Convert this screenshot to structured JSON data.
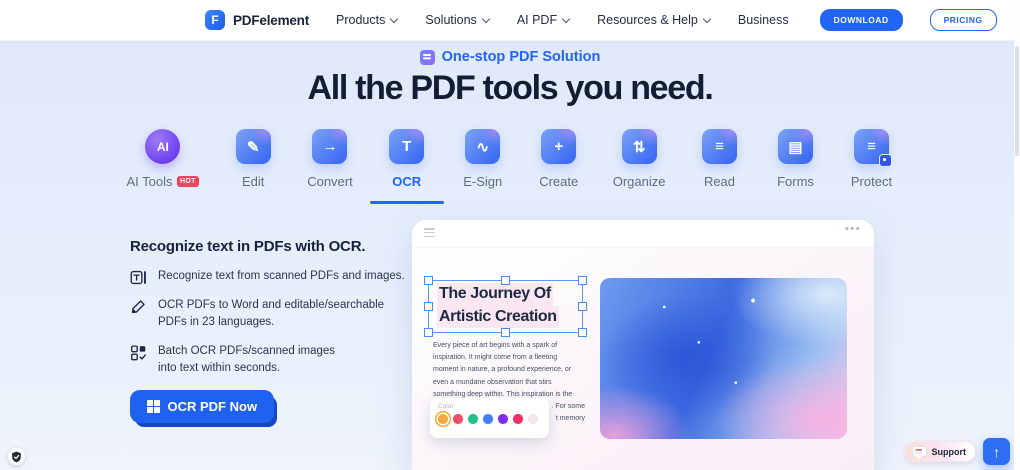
{
  "header": {
    "brand": "PDFelement",
    "logo_glyph": "F",
    "nav": [
      {
        "label": "Products"
      },
      {
        "label": "Solutions"
      },
      {
        "label": "AI PDF"
      },
      {
        "label": "Resources & Help"
      },
      {
        "label": "Business"
      }
    ],
    "download_label": "DOWNLOAD",
    "pricing_label": "PRICING"
  },
  "hero": {
    "badge": "One-stop PDF Solution",
    "title": "All the PDF tools you need."
  },
  "tabs": [
    {
      "label": "AI Tools",
      "glyph": "AI",
      "badge": "HOT"
    },
    {
      "label": "Edit",
      "glyph": "✎"
    },
    {
      "label": "Convert",
      "glyph": "→"
    },
    {
      "label": "OCR",
      "glyph": "T"
    },
    {
      "label": "E-Sign",
      "glyph": "∿"
    },
    {
      "label": "Create",
      "glyph": "+"
    },
    {
      "label": "Organize",
      "glyph": "⇅"
    },
    {
      "label": "Read",
      "glyph": "≡"
    },
    {
      "label": "Forms",
      "glyph": "▤"
    },
    {
      "label": "Protect",
      "glyph": "≡"
    }
  ],
  "feature": {
    "heading": "Recognize text in PDFs with OCR.",
    "bullets": [
      {
        "text": "Recognize text from scanned PDFs and images."
      },
      {
        "text": "OCR PDFs to Word and editable/searchable PDFs in 23 languages."
      },
      {
        "text": "Batch OCR PDFs/scanned images into text within seconds."
      }
    ],
    "cta_label": "OCR PDF Now"
  },
  "preview": {
    "doc_title": [
      "The Journey Of",
      "Artistic Creation"
    ],
    "body_lines": [
      "Every piece of art begins with a spark of",
      "inspiration. It might come from a fleeting",
      "moment in nature, a profound experience, or",
      "even a mundane observation that stirs",
      "something deep within. This inspiration is the"
    ],
    "obscured_fragments": [
      ". For some",
      "t memory"
    ],
    "menu_dots": "•••",
    "color_popup": {
      "label": "Color",
      "swatches": [
        "#F2A93B",
        "#F04E68",
        "#21BE8D",
        "#4080F8",
        "#7B2FF0",
        "#EF2E63",
        "#F7E3EA"
      ]
    }
  },
  "floating": {
    "support_label": "Support",
    "totop_glyph": "↑"
  },
  "colors": {
    "accent_blue": "#2264F4",
    "hot_red": "#F0415F",
    "cta_blue": "#2062F0",
    "page_bg": "#E3EDFB"
  }
}
